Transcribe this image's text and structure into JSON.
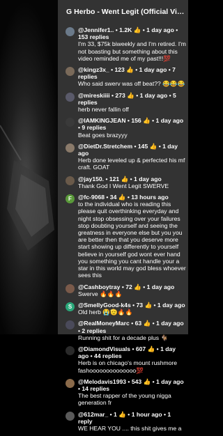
{
  "header": {
    "title": "G Herbo - Went Legit (Official Vid..."
  },
  "comments": [
    {
      "meta": "@Jennifer1.. • 1.2K 👍 • 1 day ago • 153 replies",
      "text": "I'm 33, $75k biweekly and I'm retired. I'm not boasting but something about this video reminded me of my past!!!💯",
      "avatar_color": "#6b7a8a"
    },
    {
      "meta": "@kingz3x_ • 123 👍 • 1 day ago • 7 replies",
      "text": "Who said swerv was off beat?? 😂😂😂",
      "avatar_color": "#7a6a5a"
    },
    {
      "meta": "@mireskiiii • 273 👍 • 1 day ago • 5 replies",
      "text": "herb never fallin off",
      "avatar_color": "#5a5a6a"
    },
    {
      "meta": "@IAMKINGJEAN • 156 👍 • 1 day ago • 9 replies",
      "text": "Beat goes brazyyy",
      "avatar_color": "#3a3a3a"
    },
    {
      "meta": "@DietDr.Stretchem • 145 👍 • 1 day ago",
      "text": "Herb done leveled up & perfected his mf craft. GOAT",
      "avatar_color": "#8a7a6a"
    },
    {
      "meta": "@jay150. • 121 👍 • 1 day ago",
      "text": "Thank God I Went Legit SWERVE",
      "avatar_color": "#6a5a4a"
    },
    {
      "meta": "@fc-9068 • 34 👍 • 13 hours ago",
      "text": "to the individual who is reading this please quit overthinking everyday and night stop obsessing over your failures stop doubting yourself and seeing the greatness in everyone else but you you are better then that you deserve more start showing up differently to yourself believe in yourself god wont ever hand you something you cant handle your a star in this world may god bless whoever sees this",
      "avatar_color": "#5a9a3a",
      "avatar_letter": "F"
    },
    {
      "meta": "@Cashboytray • 72 👍 • 1 day ago",
      "text": "Swerve 🔥🔥🔥",
      "avatar_color": "#7a5a4a"
    },
    {
      "meta": "@SmellyGood-k4s • 73 👍 • 1 day ago",
      "text": "Old herb 😭🫡🔥🔥",
      "avatar_color": "#2aa87a",
      "avatar_letter": "S"
    },
    {
      "meta": "@RealMoneyMarc • 63 👍 • 1 day ago • 2 replies",
      "text": "Running shit for a decade plus 🐐",
      "avatar_color": "#4a4a5a"
    },
    {
      "meta": "@DiamondVisuals • 607 👍 • 1 day ago • 44 replies",
      "text": "Herb is on chicago's mount rushmore fashoooooooooooooo💯",
      "avatar_color": "#2a2a2a"
    },
    {
      "meta": "@Melodavis1993 • 543 👍 • 1 day ago • 14 replies",
      "text": "The best rapper of the young nigga generation fr",
      "avatar_color": "#8a6a4a"
    },
    {
      "meta": "@612mar_ • 1 👍 • 1 hour ago • 1 reply",
      "text": "WE HEAR YOU .... this shit gives me a",
      "avatar_color": "#5a5a5a"
    }
  ]
}
